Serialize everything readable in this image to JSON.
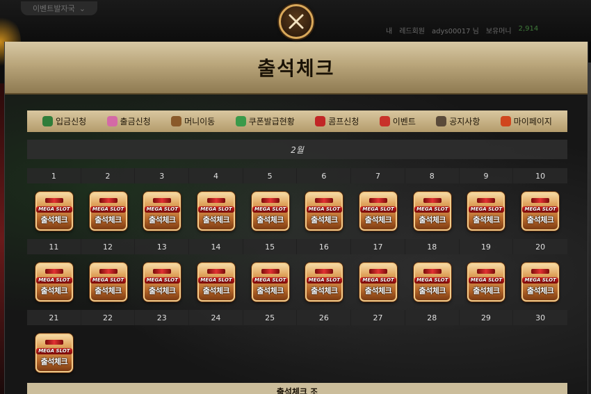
{
  "background": {
    "dropdown_label": "이벤트발자국",
    "userbar": {
      "item1": "내",
      "item2": "레드회원",
      "username": "adys00017 님",
      "balance_label": "보유머니",
      "balance": "2,914"
    }
  },
  "modal": {
    "title": "출석체크",
    "close_icon": "close-x-icon",
    "nav": [
      {
        "label": "입금신청",
        "icon": "money-bag-icon",
        "color": "#2f7d3a"
      },
      {
        "label": "출금신청",
        "icon": "coin-icon",
        "color": "#d46aa6"
      },
      {
        "label": "머니이동",
        "icon": "wallet-icon",
        "color": "#8a5a2a"
      },
      {
        "label": "쿠폰발급현황",
        "icon": "coupon-icon",
        "color": "#3a9a4a"
      },
      {
        "label": "콤프신청",
        "icon": "cherry-icon",
        "color": "#c12626"
      },
      {
        "label": "이벤트",
        "icon": "star-icon",
        "color": "#c8322a"
      },
      {
        "label": "공지사항",
        "icon": "notice-icon",
        "color": "#5a4a3a"
      },
      {
        "label": "마이페이지",
        "icon": "crown-icon",
        "color": "#d0461e"
      }
    ],
    "month": "2월",
    "badge": {
      "brand": "MEGA SLOT",
      "label": "출석체크"
    },
    "weeks": [
      {
        "days": [
          "1",
          "2",
          "3",
          "4",
          "5",
          "6",
          "7",
          "8",
          "9",
          "10"
        ],
        "checked": [
          true,
          true,
          true,
          true,
          true,
          true,
          true,
          true,
          true,
          true
        ]
      },
      {
        "days": [
          "11",
          "12",
          "13",
          "14",
          "15",
          "16",
          "17",
          "18",
          "19",
          "20"
        ],
        "checked": [
          true,
          true,
          true,
          true,
          true,
          true,
          true,
          true,
          true,
          true
        ]
      },
      {
        "days": [
          "21",
          "22",
          "23",
          "24",
          "25",
          "26",
          "27",
          "28",
          "29",
          "30"
        ],
        "checked": [
          true,
          false,
          false,
          false,
          false,
          false,
          false,
          false,
          false,
          false
        ]
      }
    ],
    "footer_label": "출석체크 조"
  },
  "colors": {
    "header_gold": "#b9a57a",
    "badge_orange": "#e0a35c",
    "close_ring": "#d9a85a"
  }
}
